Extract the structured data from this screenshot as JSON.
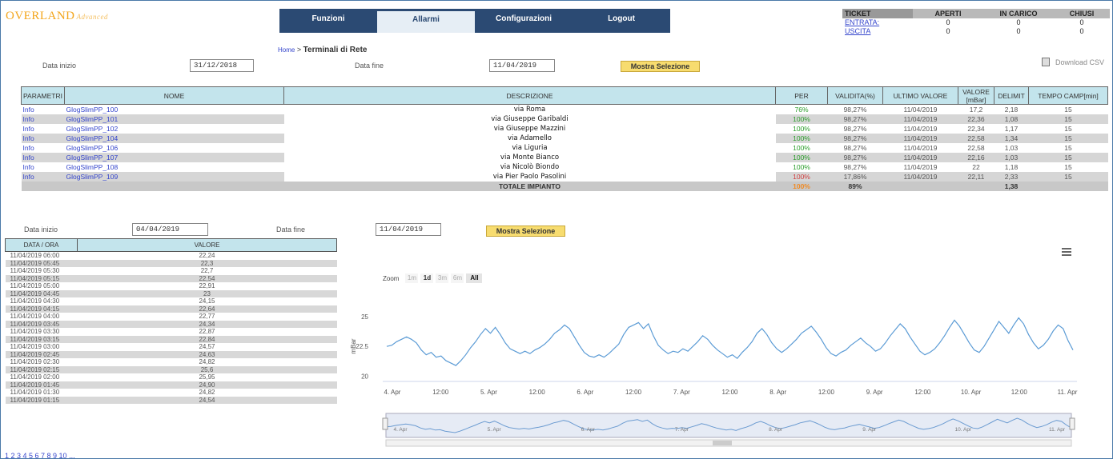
{
  "brand": {
    "name": "OVERLAND",
    "suffix": "Advanced"
  },
  "nav": [
    {
      "label": "Funzioni"
    },
    {
      "label": "Allarmi",
      "active": true
    },
    {
      "label": "Configurazioni"
    },
    {
      "label": "Logout"
    }
  ],
  "tickets": {
    "headers": [
      "TICKET",
      "APERTI",
      "IN CARICO",
      "CHIUSI"
    ],
    "rows": [
      {
        "label": "ENTRATA:",
        "values": [
          "0",
          "0",
          "0"
        ]
      },
      {
        "label": "USCITA",
        "values": [
          "0",
          "0",
          "0"
        ]
      }
    ]
  },
  "breadcrumb": {
    "home": "Home",
    "sep": ">",
    "title": "Terminali di Rete"
  },
  "filter_top": {
    "start_label": "Data inizio",
    "start_value": "31/12/2018",
    "end_label": "Data fine",
    "end_value": "11/04/2019",
    "button": "Mostra Selezione",
    "download": "Download CSV"
  },
  "main_table": {
    "headers": [
      "PARAMETRI",
      "NOME",
      "DESCRIZIONE",
      "PER",
      "VALIDITA(%)",
      "ULTIMO VALORE",
      "VALORE [mBar]",
      "DELIMIT",
      "TEMPO CAMP[min]"
    ],
    "rows": [
      {
        "param": "Info",
        "nome": "GlogSlimPP_100",
        "desc": "via Roma",
        "per": "76%",
        "per_color": "g",
        "valid": "98,27%",
        "last": "11/04/2019",
        "val": "17,2",
        "delim": "2,18",
        "tempo": "15"
      },
      {
        "param": "Info",
        "nome": "GlogSlimPP_101",
        "desc": "via Giuseppe Garibaldi",
        "per": "100%",
        "per_color": "g",
        "valid": "98,27%",
        "last": "11/04/2019",
        "val": "22,36",
        "delim": "1,08",
        "tempo": "15"
      },
      {
        "param": "Info",
        "nome": "GlogSlimPP_102",
        "desc": "via Giuseppe Mazzini",
        "per": "100%",
        "per_color": "g",
        "valid": "98,27%",
        "last": "11/04/2019",
        "val": "22,34",
        "delim": "1,17",
        "tempo": "15"
      },
      {
        "param": "Info",
        "nome": "GlogSlimPP_104",
        "desc": "via Adamello",
        "per": "100%",
        "per_color": "g",
        "valid": "98,27%",
        "last": "11/04/2019",
        "val": "22,58",
        "delim": "1,34",
        "tempo": "15"
      },
      {
        "param": "Info",
        "nome": "GlogSlimPP_106",
        "desc": "via Liguria",
        "per": "100%",
        "per_color": "g",
        "valid": "98,27%",
        "last": "11/04/2019",
        "val": "22,58",
        "delim": "1,03",
        "tempo": "15"
      },
      {
        "param": "Info",
        "nome": "GlogSlimPP_107",
        "desc": "via Monte Bianco",
        "per": "100%",
        "per_color": "g",
        "valid": "98,27%",
        "last": "11/04/2019",
        "val": "22,16",
        "delim": "1,03",
        "tempo": "15"
      },
      {
        "param": "Info",
        "nome": "GlogSlimPP_108",
        "desc": "via Nicolò Biondo",
        "per": "100%",
        "per_color": "g",
        "valid": "98,27%",
        "last": "11/04/2019",
        "val": "22",
        "delim": "1,18",
        "tempo": "15"
      },
      {
        "param": "Info",
        "nome": "GlogSlimPP_109",
        "desc": "via Pier Paolo Pasolini",
        "per": "100%",
        "per_color": "r",
        "valid": "17,86%",
        "last": "11/04/2019",
        "val": "22,11",
        "delim": "2,33",
        "tempo": "15"
      }
    ],
    "total": {
      "label": "TOTALE IMPIANTO",
      "per": "100%",
      "valid": "89%",
      "delim": "1,38"
    }
  },
  "filter_bottom": {
    "start_label": "Data inizio",
    "start_value": "04/04/2019",
    "end_label": "Data fine",
    "end_value": "11/04/2019",
    "button": "Mostra Selezione"
  },
  "value_table": {
    "headers": [
      "DATA / ORA",
      "VALORE"
    ],
    "rows": [
      [
        "11/04/2019 06:00",
        "22,24"
      ],
      [
        "11/04/2019 05:45",
        "22,3"
      ],
      [
        "11/04/2019 05:30",
        "22,7"
      ],
      [
        "11/04/2019 05:15",
        "22,54"
      ],
      [
        "11/04/2019 05:00",
        "22,91"
      ],
      [
        "11/04/2019 04:45",
        "23"
      ],
      [
        "11/04/2019 04:30",
        "24,15"
      ],
      [
        "11/04/2019 04:15",
        "22,64"
      ],
      [
        "11/04/2019 04:00",
        "22,77"
      ],
      [
        "11/04/2019 03:45",
        "24,34"
      ],
      [
        "11/04/2019 03:30",
        "22,87"
      ],
      [
        "11/04/2019 03:15",
        "22,84"
      ],
      [
        "11/04/2019 03:00",
        "24,57"
      ],
      [
        "11/04/2019 02:45",
        "24,63"
      ],
      [
        "11/04/2019 02:30",
        "24,82"
      ],
      [
        "11/04/2019 02:15",
        "25,6"
      ],
      [
        "11/04/2019 02:00",
        "25,95"
      ],
      [
        "11/04/2019 01:45",
        "24,90"
      ],
      [
        "11/04/2019 01:30",
        "24,82"
      ],
      [
        "11/04/2019 01:15",
        "24,54"
      ]
    ],
    "pager": "1 2 3 4 5 6 7 8 9 10 ..."
  },
  "zoom": {
    "label": "Zoom",
    "buttons": [
      "1m",
      "1d",
      "3m",
      "6m",
      "All"
    ],
    "active": "1d"
  },
  "chart_data": {
    "type": "line",
    "ylabel": "mBar",
    "ylim": [
      19.7,
      25.4
    ],
    "yticks": [
      "25",
      "22.5",
      "20"
    ],
    "xticks": [
      "4. Apr",
      "12:00",
      "5. Apr",
      "12:00",
      "6. Apr",
      "12:00",
      "7. Apr",
      "12:00",
      "8. Apr",
      "12:00",
      "9. Apr",
      "12:00",
      "10. Apr",
      "12:00",
      "11. Apr"
    ],
    "navigator_ticks": [
      "4. Apr",
      "5. Apr",
      "6. Apr",
      "7. Apr",
      "8. Apr",
      "9. Apr",
      "10. Apr",
      "11. Apr"
    ],
    "series": [
      {
        "color": "#5b9bd5",
        "values": [
          22.5,
          22.6,
          22.9,
          23.1,
          23.3,
          23.1,
          22.8,
          22.2,
          21.8,
          22.0,
          21.6,
          21.7,
          21.3,
          21.1,
          20.9,
          21.3,
          21.8,
          22.4,
          22.9,
          23.5,
          24.0,
          23.6,
          24.1,
          23.5,
          22.8,
          22.3,
          22.1,
          21.9,
          22.1,
          21.9,
          22.2,
          22.4,
          22.7,
          23.1,
          23.6,
          23.9,
          24.3,
          24.0,
          23.3,
          22.6,
          22.0,
          21.7,
          21.6,
          21.8,
          21.6,
          21.9,
          22.3,
          22.7,
          23.5,
          24.1,
          24.3,
          24.5,
          24.0,
          24.4,
          23.4,
          22.6,
          22.2,
          21.9,
          22.1,
          22.0,
          22.3,
          22.1,
          22.5,
          22.9,
          23.4,
          23.1,
          22.6,
          22.2,
          21.9,
          21.6,
          21.8,
          21.5,
          22.0,
          22.4,
          22.9,
          23.6,
          24.0,
          23.5,
          22.8,
          22.3,
          22.0,
          22.3,
          22.7,
          23.1,
          23.6,
          23.9,
          24.2,
          23.7,
          23.1,
          22.4,
          21.9,
          21.7,
          22.0,
          22.2,
          22.6,
          22.9,
          23.2,
          22.8,
          22.5,
          22.1,
          22.3,
          22.8,
          23.4,
          23.9,
          24.4,
          24.0,
          23.3,
          22.7,
          22.1,
          21.8,
          22.0,
          22.3,
          22.8,
          23.4,
          24.1,
          24.7,
          24.2,
          23.5,
          22.8,
          22.2,
          22.0,
          22.5,
          23.2,
          23.9,
          24.6,
          24.1,
          23.6,
          24.3,
          24.9,
          24.4,
          23.5,
          22.8,
          22.3,
          22.6,
          23.1,
          23.8,
          24.3,
          24.0,
          23.0,
          22.2
        ]
      }
    ]
  }
}
